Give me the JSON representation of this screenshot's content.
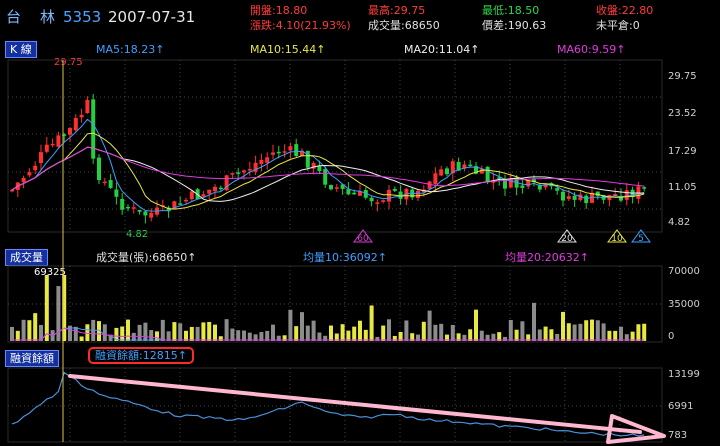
{
  "header": {
    "name": "台　林",
    "code": "5353",
    "date": "2007-07-31",
    "quotes": [
      {
        "label": "開盤:18.80",
        "color": "#ff3b3b"
      },
      {
        "label": "最高:29.75",
        "color": "#ff3b3b"
      },
      {
        "label": "最低:18.50",
        "color": "#27d84a"
      },
      {
        "label": "收盤:22.80",
        "color": "#ff3b3b"
      },
      {
        "label": "漲跌:4.10(21.93%)",
        "color": "#ff3b3b"
      },
      {
        "label": "成交量:68650",
        "color": "#e0e0e0"
      },
      {
        "label": "價差:190.63",
        "color": "#e0e0e0"
      },
      {
        "label": "未平倉:0",
        "color": "#e0e0e0"
      }
    ]
  },
  "kline": {
    "tab": "K 線",
    "ma": [
      {
        "label": "MA5:18.23↑",
        "color": "#3fa0ff"
      },
      {
        "label": "MA10:15.44↑",
        "color": "#e8e842"
      },
      {
        "label": "MA20:11.04↑",
        "color": "#f0f0f0"
      },
      {
        "label": "MA60:9.59↑",
        "color": "#e13be1"
      }
    ],
    "y_ticks": [
      "29.75",
      "23.52",
      "17.29",
      "11.05",
      "4.82"
    ],
    "high_label": "29.75",
    "low_label": "4.82",
    "markers": [
      {
        "label": "60",
        "color": "#d63bd6"
      },
      {
        "label": "20",
        "color": "#e0e0e0"
      },
      {
        "label": "10",
        "color": "#e8e842"
      },
      {
        "label": "5",
        "color": "#3fa0ff"
      }
    ]
  },
  "volume": {
    "tab": "成交量",
    "labels": [
      {
        "label": "成交量(張):68650↑",
        "color": "#e0e0e0"
      },
      {
        "label": "均量10:36092↑",
        "color": "#3fa0ff"
      },
      {
        "label": "均量20:20632↑",
        "color": "#e13be1"
      }
    ],
    "y_ticks": [
      "70000",
      "35000",
      "0"
    ],
    "peak_label": "69325"
  },
  "margin": {
    "tab": "融資餘額",
    "value_label": "融資餘額:12815↑",
    "y_ticks": [
      "13199",
      "6991",
      "783"
    ]
  }
}
